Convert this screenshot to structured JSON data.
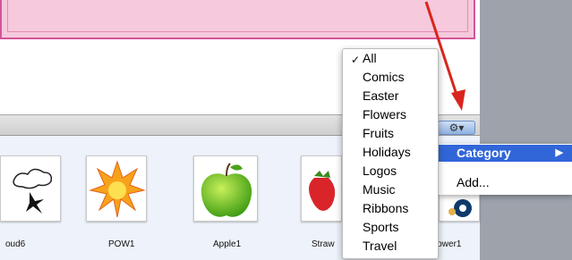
{
  "colors": {
    "accent": "#3166d9",
    "card_pink": "#f6c9dc",
    "card_border": "#d3559a",
    "arrow_red": "#d9251d",
    "panel_gray": "#9da2ab"
  },
  "toolbar": {
    "gear_icon": "gear-icon",
    "gear_glyph": "⚙▾"
  },
  "category_popup": {
    "selected": "All",
    "check_glyph": "✓",
    "items": [
      "All",
      "Comics",
      "Easter",
      "Flowers",
      "Fruits",
      "Holidays",
      "Logos",
      "Music",
      "Ribbons",
      "Sports",
      "Travel"
    ]
  },
  "context_menu": {
    "category_label": "Category",
    "submenu_glyph": "▶",
    "add_label": "Add..."
  },
  "clipart": {
    "items": [
      {
        "label": "oud6",
        "icon": "cloud-icon"
      },
      {
        "label": "POW1",
        "icon": "pow-burst-icon"
      },
      {
        "label": "Apple1",
        "icon": "apple-icon"
      },
      {
        "label": "Straw",
        "icon": "strawberry-icon"
      },
      {
        "label": "lower1",
        "icon": "flower-icon"
      }
    ]
  }
}
